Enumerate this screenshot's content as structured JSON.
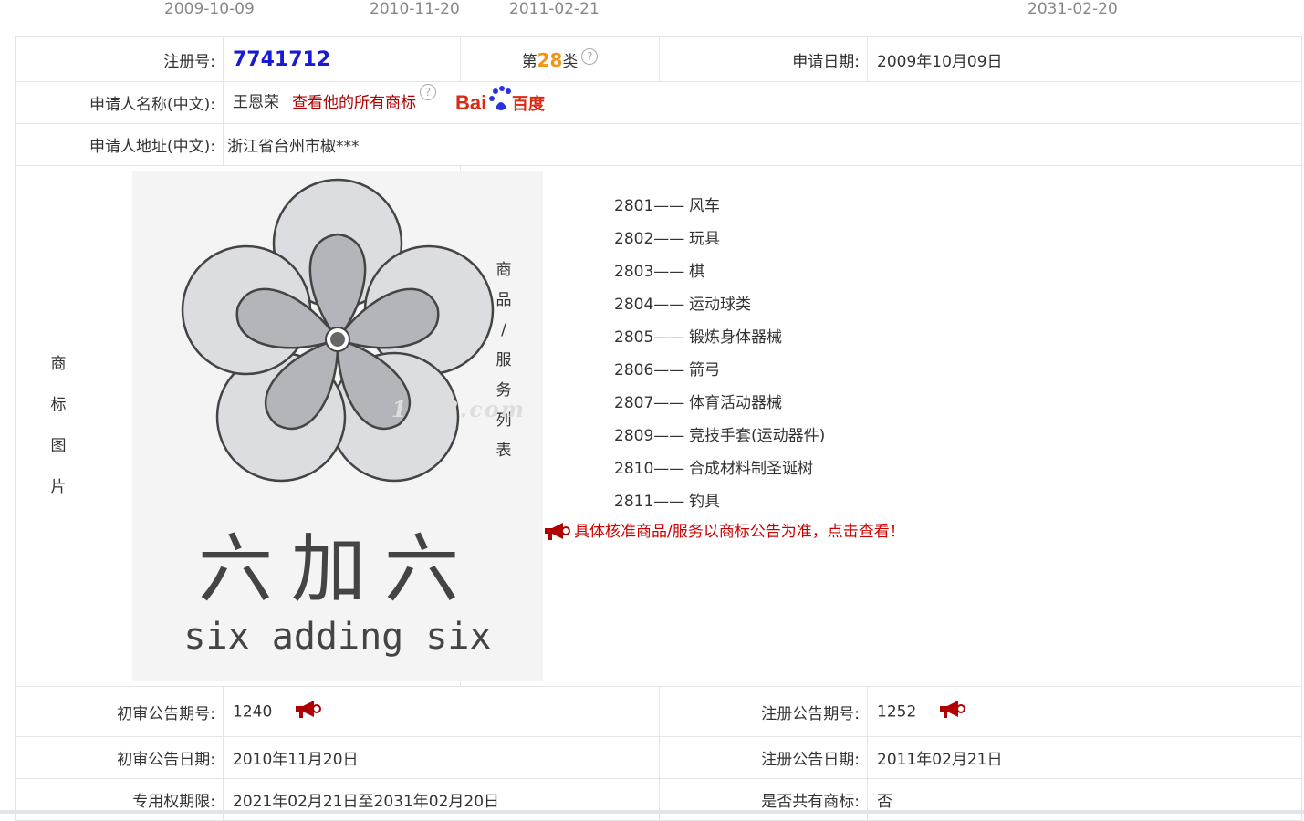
{
  "timeline": [
    "2009-10-09",
    "2010-11-20",
    "2011-02-21",
    "2031-02-20"
  ],
  "row1": {
    "reg_label": "注册号:",
    "reg_no": "7741712",
    "class_prefix": "第",
    "class_num": "28",
    "class_suffix": "类",
    "apply_date_label": "申请日期:",
    "apply_date": "2009年10月09日"
  },
  "applicant": {
    "name_label": "申请人名称(中文):",
    "name": "王恩荣",
    "all_marks_link": "查看他的所有商标",
    "baidu_text": "Bai",
    "baidu_suffix": "百度"
  },
  "address": {
    "label": "申请人地址(中文):",
    "value": "浙江省台州市椒***"
  },
  "mark": {
    "label_chars": [
      "商",
      "标",
      "图",
      "片"
    ],
    "cn_text": "六加六",
    "en_text": "six adding six"
  },
  "goods": {
    "label_chars": [
      "商",
      "品",
      "/",
      "服",
      "务",
      "列",
      "表"
    ],
    "watermark": "1688.com",
    "items": [
      {
        "code": "2801——",
        "name": "风车"
      },
      {
        "code": "2802——",
        "name": "玩具"
      },
      {
        "code": "2803——",
        "name": "棋"
      },
      {
        "code": "2804——",
        "name": "运动球类"
      },
      {
        "code": "2805——",
        "name": "锻炼身体器械"
      },
      {
        "code": "2806——",
        "name": "箭弓"
      },
      {
        "code": "2807——",
        "name": "体育活动器械"
      },
      {
        "code": "2809——",
        "name": "竞技手套(运动器件)"
      },
      {
        "code": "2810——",
        "name": "合成材料制圣诞树"
      },
      {
        "code": "2811——",
        "name": "钓具"
      }
    ],
    "notice": "具体核准商品/服务以商标公告为准，点击查看！"
  },
  "prelim": {
    "issue_label": "初审公告期号:",
    "issue_no": "1240",
    "date_label": "初审公告日期:",
    "date": "2010年11月20日"
  },
  "registration": {
    "issue_label": "注册公告期号:",
    "issue_no": "1252",
    "date_label": "注册公告日期:",
    "date": "2011年02月21日"
  },
  "term": {
    "label": "专用权期限:",
    "value": "2021年02月21日至2031年02月20日",
    "shared_label": "是否共有商标:",
    "shared_value": "否"
  },
  "colors": {
    "reg_no": "#1a1ad6",
    "class_num": "#f29418",
    "link_red": "#b00000",
    "notice_red": "#d00000"
  }
}
